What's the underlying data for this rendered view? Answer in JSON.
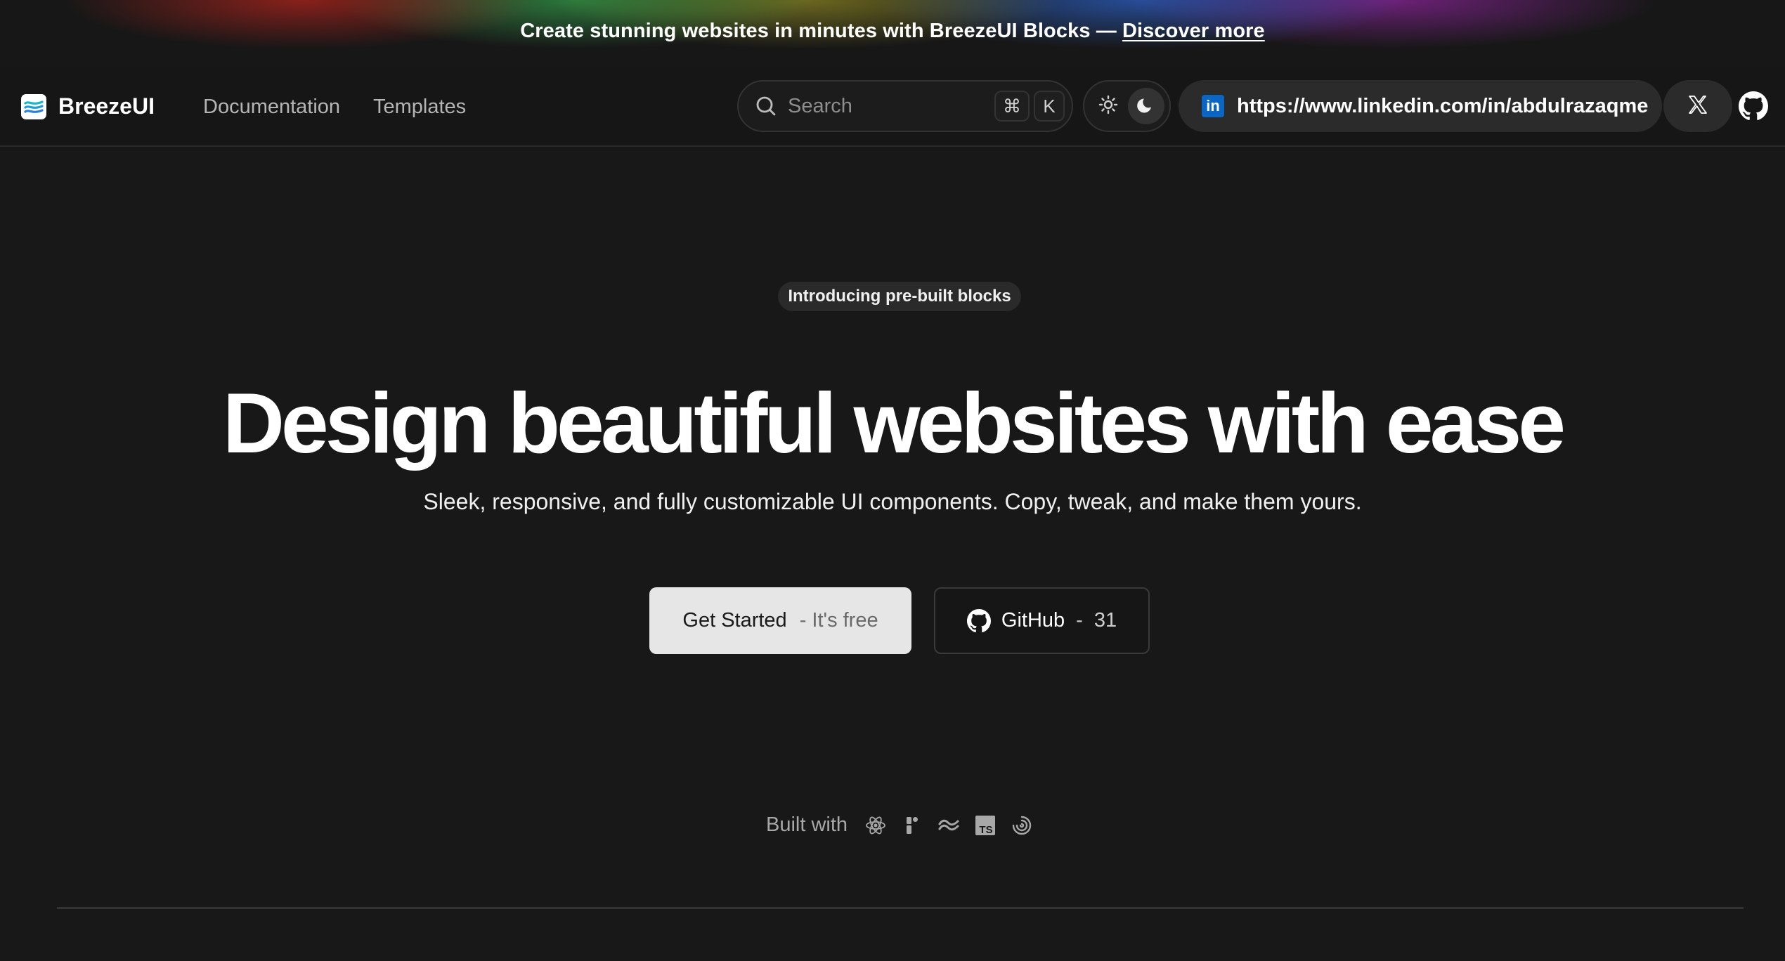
{
  "banner": {
    "text": "Create stunning websites in minutes with BreezeUI Blocks — ",
    "link_label": "Discover more"
  },
  "nav": {
    "brand": "BreezeUI",
    "links": [
      {
        "label": "Documentation"
      },
      {
        "label": "Templates"
      }
    ],
    "search": {
      "placeholder": "Search",
      "shortcut": [
        "⌘",
        "K"
      ]
    },
    "theme": {
      "active": "dark"
    },
    "linkedin": {
      "icon_text": "in",
      "url": "https://www.linkedin.com/in/abdulrazaqme"
    }
  },
  "hero": {
    "badge": "Introducing pre-built blocks",
    "title": "Design beautiful websites with ease",
    "subtitle": "Sleek, responsive, and fully customizable UI components. Copy, tweak, and make them yours.",
    "cta_primary": {
      "label": "Get Started",
      "sub": "- It's free"
    },
    "cta_github": {
      "label": "GitHub",
      "separator": "-",
      "count": "31"
    },
    "built_with": {
      "label": "Built with",
      "icons": [
        "react-icon",
        "framer-icon",
        "tailwind-icon",
        "typescript-icon",
        "motion-icon"
      ],
      "ts_text": "TS"
    }
  },
  "colors": {
    "background": "#181818",
    "primary_button": "#e6e6e6",
    "linkedin": "#0a66c2"
  }
}
